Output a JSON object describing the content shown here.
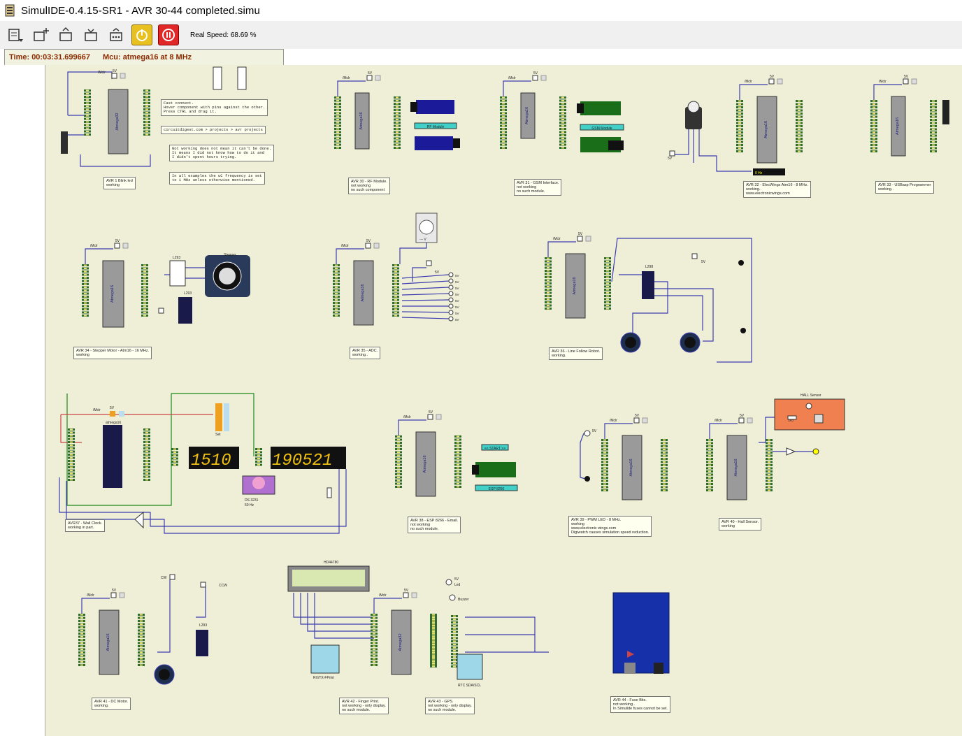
{
  "window": {
    "title": "SimulIDE-0.4.15-SR1  -  AVR 30-44 completed.simu"
  },
  "toolbar": {
    "buttons": [
      "file-menu-icon",
      "new-circuit-icon",
      "open-circuit-icon",
      "save-circuit-icon",
      "save-as-icon"
    ],
    "power_button": "power-icon",
    "pause_button": "pause-icon",
    "real_speed": "Real Speed: 68.69 %"
  },
  "status": {
    "time": "Time: 00:03:31.699667",
    "mcu": "Mcu: atmega16 at 8 MHz"
  },
  "colors": {
    "canvas": "#efefd8",
    "wire": "#3c3cb0",
    "chip": "#9a9a9a",
    "pin": "#2e6b2e",
    "note_bg": "#fffff0"
  },
  "notes": [
    {
      "id": "avr1",
      "text": "AVR 1 Blink led\nworking"
    },
    {
      "id": "tip1",
      "text": "Fast connect.\nHover component with pins against the other.\nPress CTRL and drag it."
    },
    {
      "id": "tip2",
      "text": "circuitdigest.com > projects > avr projects"
    },
    {
      "id": "tip3",
      "text": "Not working does not mean it can't be done.\nIt means I did not know how to do it and\nI didn't spent hours trying."
    },
    {
      "id": "tip4",
      "text": "In all examples the uC frequency is set\nto 1 MHz unless otherwise mentioned."
    },
    {
      "id": "avr30",
      "text": "AVR 30 - RF Module.\nnot working\nno such component"
    },
    {
      "id": "avr31",
      "text": "AVR 31 - GSM Interface.\nnot working\nno such module."
    },
    {
      "id": "avr32",
      "text": "AVR 32 - ElecWings Atm16 - 8 MHz.\nworking..\nwww.electronicwings.com"
    },
    {
      "id": "avr33",
      "text": "AVR 33 - USBasp Programmer\nworking.."
    },
    {
      "id": "avr34",
      "text": "AVR 34 - Stepper Motor - Atm16 - 16 MHz.\nworking"
    },
    {
      "id": "avr35",
      "text": "AVR 35 - ADC.\nworking.."
    },
    {
      "id": "avr36",
      "text": "AVR 36 - Line Follow Robot.\nworking."
    },
    {
      "id": "avr37",
      "text": "AVR37 - Wall Clock.\nworking in part."
    },
    {
      "id": "avr38",
      "text": "AVR 38 - ESP 8266 - Email.\nnot working\nno such module."
    },
    {
      "id": "avr39",
      "text": "AVR 39 - PWM LED - 8 MHz.\nworking\nwww.electronic wings.com\nDigiwatch causes simulation speed reduction."
    },
    {
      "id": "avr40",
      "text": "AVR 40 - Hall Sensor.\nworking"
    },
    {
      "id": "avr41",
      "text": "AVR 41 - DC Motor.\nworking."
    },
    {
      "id": "avr42",
      "text": "AVR 42 - Finger Print.\nnot working - only display.\nno such module."
    },
    {
      "id": "avr43",
      "text": "AVR 43 - GPS.\nnot working - only display.\nno such module."
    },
    {
      "id": "avr44",
      "text": "AVR 44 - Fuse Bits.\nnot working..\nIn Simulide fuses cannot be set."
    }
  ],
  "labels": {
    "mclr": "/Mclr",
    "five_v": "5V",
    "atmega32": "Atmega32",
    "atmega16": "Atmega16",
    "atmega16_lower": "atmega16",
    "rf_module": "RF Module",
    "gsm_module": "GSM Module",
    "hz0": "0 Hz",
    "stepper": "Stepper",
    "l293": "L293",
    "l298": "L298",
    "adc_meter": "--- V",
    "clock_left": "1510",
    "clock_right": "190521",
    "ds3231": "DS 3231",
    "fifty_hz": "50 Hz",
    "set": "Set",
    "start": "<< START >>",
    "esp8266": "ESP 8266",
    "hall_sensor": "HALL Sensor",
    "hd44780": "HD44780",
    "rx_tx": "RX/TX-FPrint",
    "rtc": "RTC SDA/SCL",
    "cw": "CW",
    "ccw": "CCW",
    "led": "Led",
    "buzzer": "Buzzer",
    "one_k": "1K0"
  }
}
